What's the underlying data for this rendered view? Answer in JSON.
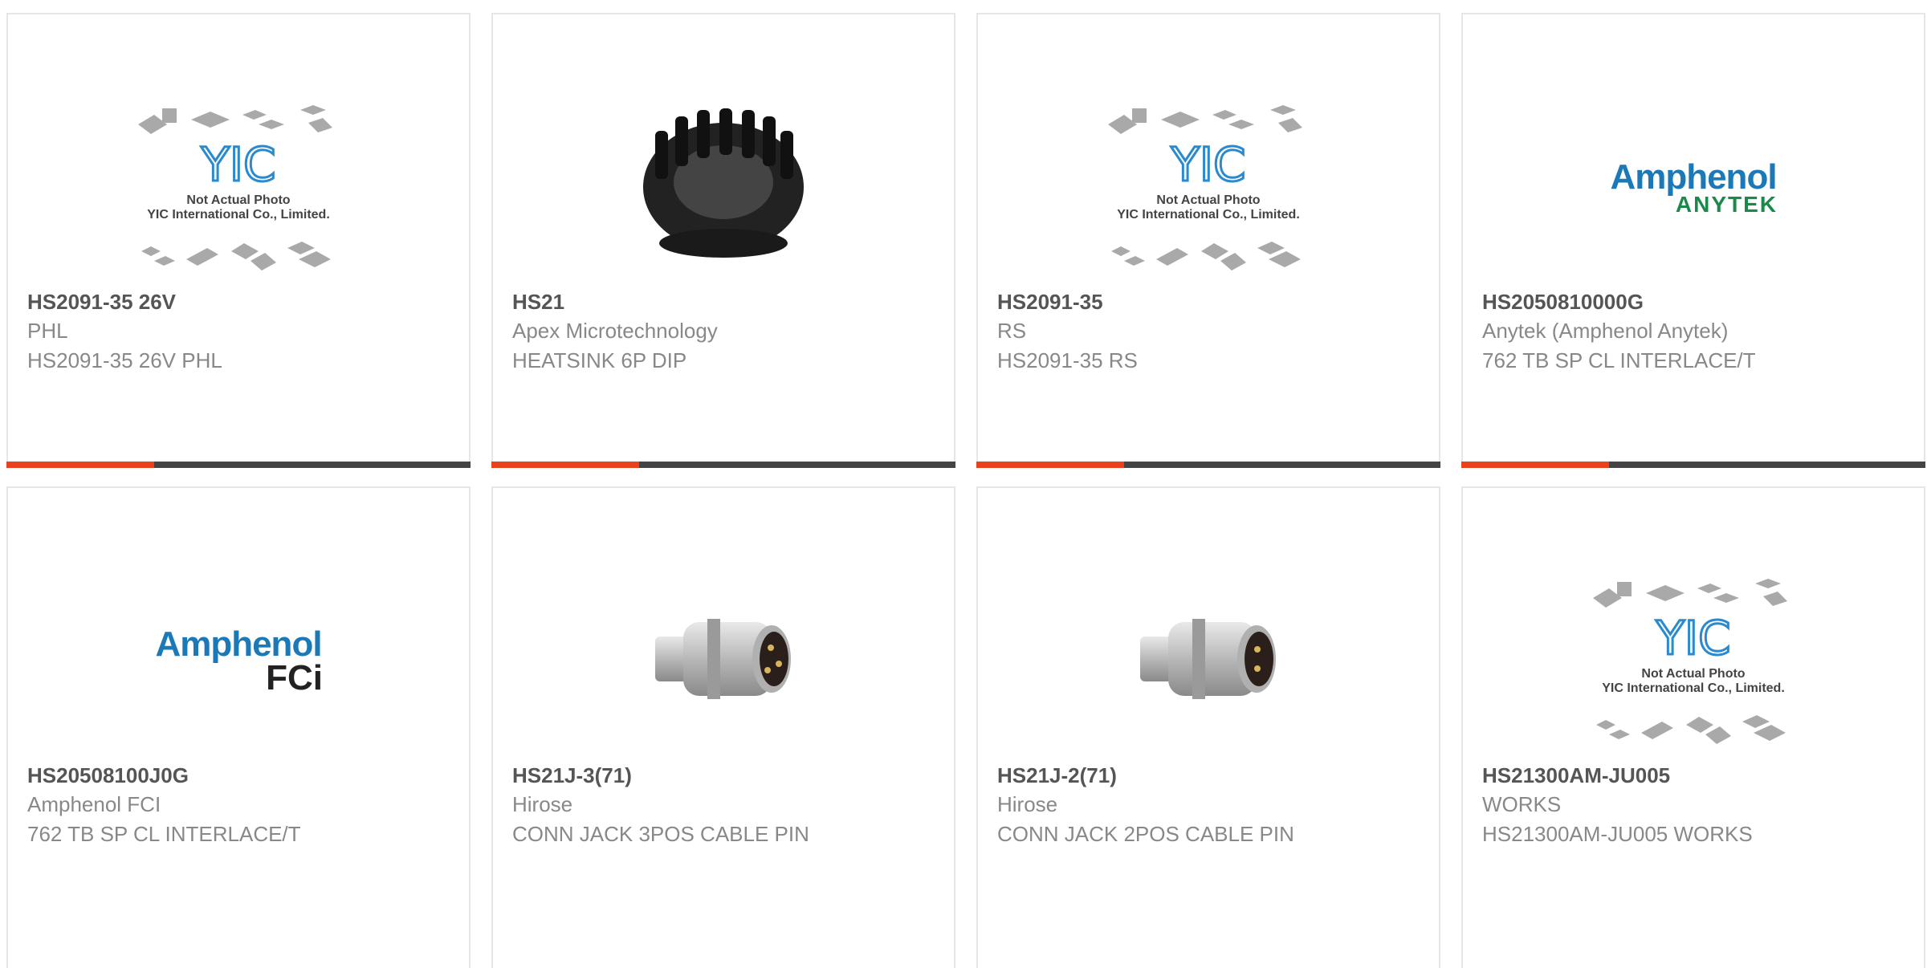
{
  "placeholder": {
    "line1": "Not Actual Photo",
    "line2": "YIC International Co., Limited.",
    "brand": "YIC"
  },
  "logos": {
    "amphenol": "Amphenol",
    "anytek": "ANYTEK",
    "fci": "FCi"
  },
  "products": [
    {
      "part": "HS2091-35 26V",
      "maker": "PHL",
      "desc": "HS2091-35 26V PHL",
      "image": "placeholder"
    },
    {
      "part": "HS21",
      "maker": "Apex Microtechnology",
      "desc": "HEATSINK 6P DIP",
      "image": "heatsink"
    },
    {
      "part": "HS2091-35",
      "maker": "RS",
      "desc": "HS2091-35 RS",
      "image": "placeholder"
    },
    {
      "part": "HS2050810000G",
      "maker": "Anytek (Amphenol Anytek)",
      "desc": "762 TB SP CL INTERLACE/T",
      "image": "amphenol-anytek-logo"
    },
    {
      "part": "HS20508100J0G",
      "maker": "Amphenol FCI",
      "desc": "762 TB SP CL INTERLACE/T",
      "image": "amphenol-fci-logo"
    },
    {
      "part": "HS21J-3(71)",
      "maker": "Hirose",
      "desc": "CONN JACK 3POS CABLE PIN",
      "image": "connector"
    },
    {
      "part": "HS21J-2(71)",
      "maker": "Hirose",
      "desc": "CONN JACK 2POS CABLE PIN",
      "image": "connector"
    },
    {
      "part": "HS21300AM-JU005",
      "maker": "WORKS",
      "desc": "HS21300AM-JU005 WORKS",
      "image": "placeholder"
    }
  ],
  "colors": {
    "accent": "#e8411b",
    "bar": "#444444",
    "border": "#e6e6e6"
  }
}
